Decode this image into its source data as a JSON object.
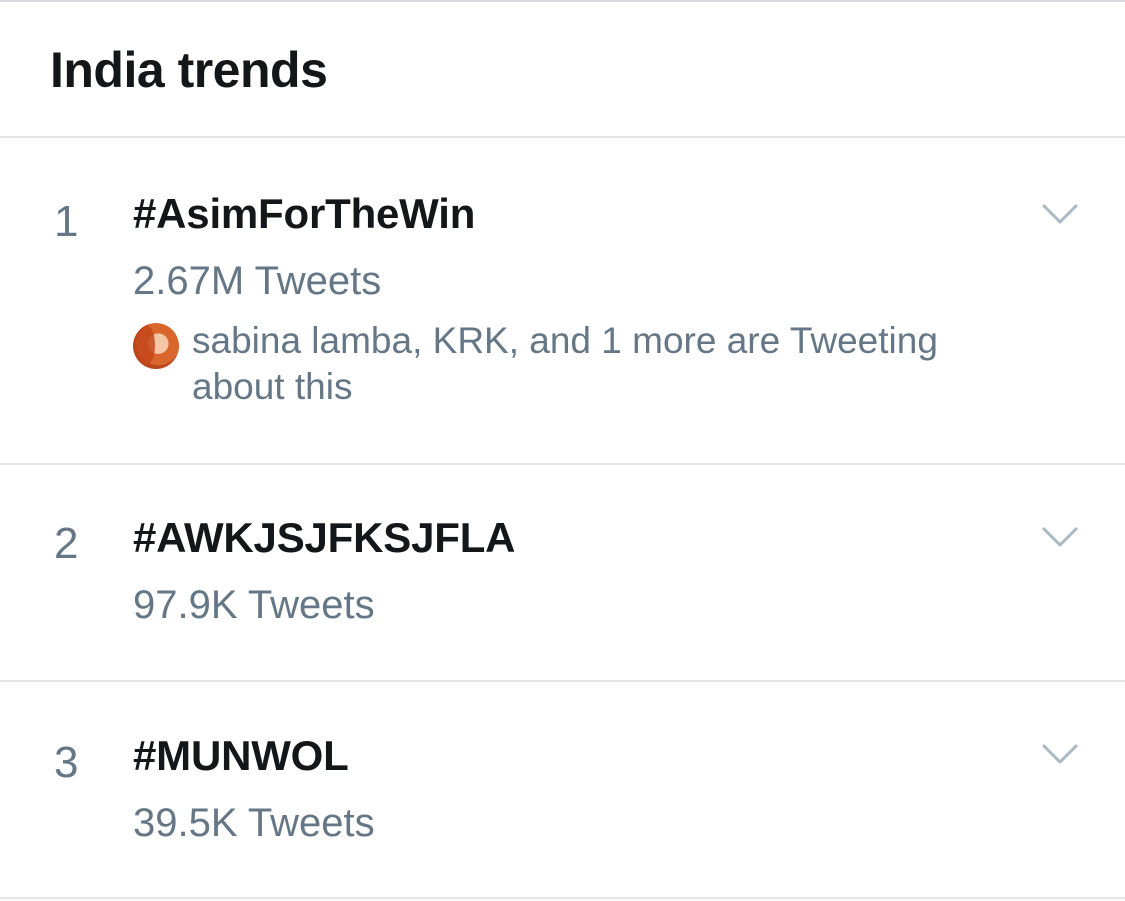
{
  "header": {
    "title": "India trends"
  },
  "trends": [
    {
      "rank": "1",
      "hashtag": "#AsimForTheWin",
      "tweet_count": "2.67M Tweets",
      "context": "sabina lamba, KRK, and 1 more are Tweeting about this",
      "icon": "chevron-down-icon"
    },
    {
      "rank": "2",
      "hashtag": "#AWKJSJFKSJFLA",
      "tweet_count": "97.9K Tweets",
      "icon": "chevron-down-icon"
    },
    {
      "rank": "3",
      "hashtag": "#MUNWOL",
      "tweet_count": "39.5K Tweets",
      "icon": "chevron-down-icon"
    }
  ],
  "colors": {
    "primary_text": "#14171a",
    "secondary_text": "#657786",
    "chevron": "#aab8c2",
    "divider": "#e1e6ea"
  }
}
